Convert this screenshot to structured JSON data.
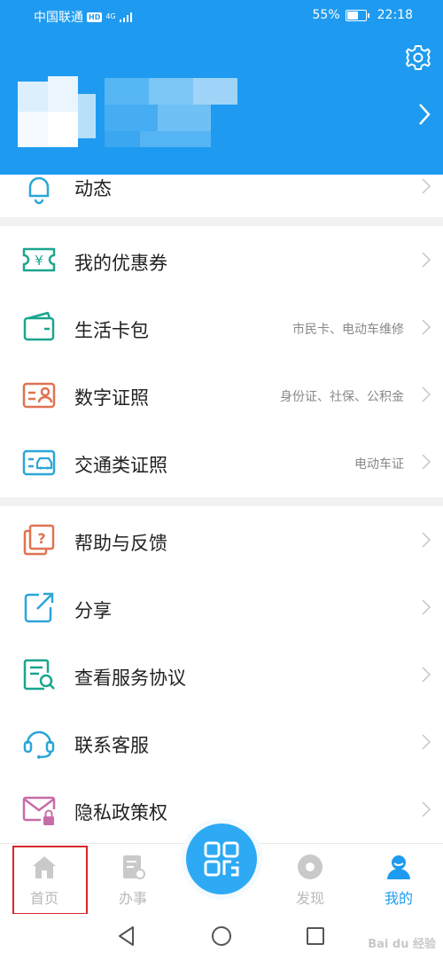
{
  "status_bar": {
    "carrier": "中国联通",
    "hd": "HD",
    "network": "4G",
    "battery": "55%",
    "time": "22:18"
  },
  "header": {
    "background_color": "#1e9bf0",
    "settings_icon": "gear-icon",
    "profile_chevron_icon": "chevron-right-icon"
  },
  "menu_group_1": [
    {
      "label": "动态",
      "icon": "bell-icon",
      "color": "#2aa6d8"
    }
  ],
  "menu_group_2": [
    {
      "label": "我的优惠券",
      "subtitle": "",
      "icon": "coupon-icon",
      "color": "#1aa58e"
    },
    {
      "label": "生活卡包",
      "subtitle": "市民卡、电动车维修",
      "icon": "wallet-icon",
      "color": "#1aa58e"
    },
    {
      "label": "数字证照",
      "subtitle": "身份证、社保、公积金",
      "icon": "id-card-icon",
      "color": "#e07350"
    },
    {
      "label": "交通类证照",
      "subtitle": "电动车证",
      "icon": "vehicle-license-icon",
      "color": "#2aa6d8"
    }
  ],
  "menu_group_3": [
    {
      "label": "帮助与反馈",
      "icon": "help-icon",
      "color": "#e07350"
    },
    {
      "label": "分享",
      "icon": "share-icon",
      "color": "#2aa6d8"
    },
    {
      "label": "查看服务协议",
      "icon": "document-search-icon",
      "color": "#1aa58e"
    },
    {
      "label": "联系客服",
      "icon": "headset-icon",
      "color": "#2aa6d8"
    },
    {
      "label": "隐私政策权",
      "icon": "mail-lock-icon",
      "color": "#c86ca8"
    }
  ],
  "tabbar": {
    "tabs": [
      {
        "label": "首页",
        "icon": "home-icon",
        "active": false
      },
      {
        "label": "办事",
        "icon": "task-icon",
        "active": false
      },
      {
        "label": "",
        "icon": "scan-icon",
        "active": false
      },
      {
        "label": "发现",
        "icon": "discover-icon",
        "active": false
      },
      {
        "label": "我的",
        "icon": "user-icon",
        "active": true
      }
    ],
    "active_color": "#1e9bf0",
    "inactive_color": "#b9b9b9"
  },
  "watermark": "Bai du 经验"
}
